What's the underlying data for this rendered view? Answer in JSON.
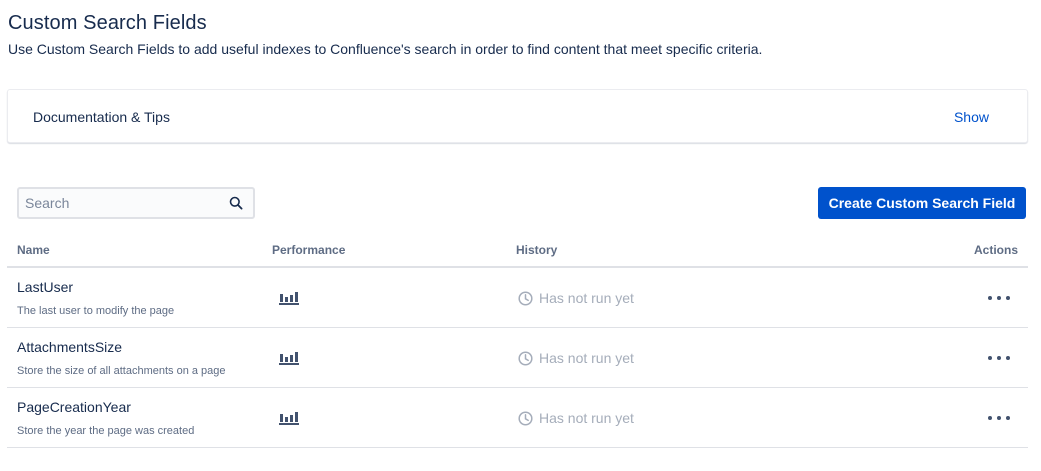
{
  "header": {
    "title": "Custom Search Fields",
    "description": "Use Custom Search Fields to add useful indexes to Confluence's search in order to find content that meet specific criteria."
  },
  "docs_panel": {
    "title": "Documentation & Tips",
    "toggle_label": "Show"
  },
  "search": {
    "placeholder": "Search",
    "value": "",
    "icon": "search-icon"
  },
  "create_button": {
    "label": "Create Custom Search Field"
  },
  "table": {
    "columns": {
      "name": "Name",
      "performance": "Performance",
      "history": "History",
      "actions": "Actions"
    },
    "rows": [
      {
        "name": "LastUser",
        "description": "The last user to modify the page",
        "performance_icon": "bar-chart-icon",
        "history": "Has not run yet",
        "actions_icon": "more-icon"
      },
      {
        "name": "AttachmentsSize",
        "description": "Store the size of all attachments on a page",
        "performance_icon": "bar-chart-icon",
        "history": "Has not run yet",
        "actions_icon": "more-icon"
      },
      {
        "name": "PageCreationYear",
        "description": "Store the year the page was created",
        "performance_icon": "bar-chart-icon",
        "history": "Has not run yet",
        "actions_icon": "more-icon"
      }
    ]
  },
  "colors": {
    "primary": "#0052CC",
    "text": "#172B4D",
    "subtle_text": "#5E6C84",
    "disabled_text": "#A5ADBA",
    "border": "#DFE1E6"
  }
}
